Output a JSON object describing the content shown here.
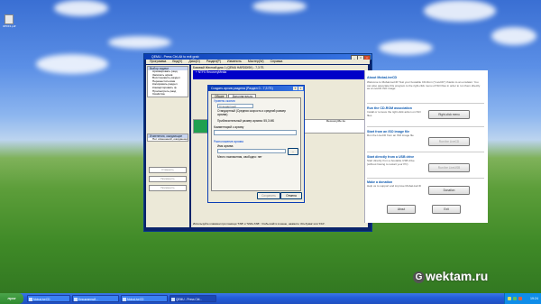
{
  "desktop": {
    "icon_label": "ttPDF1.pdf"
  },
  "qemu": {
    "title": "QEMU - Press Ctrl-Alt to exit grab",
    "menu": [
      "Программа",
      "Вид(V)",
      "Диск(D)",
      "Раздел(P)",
      "Изменить",
      "Мастер(W)",
      "Справка"
    ],
    "left_header": "Выбор задачи",
    "left_items": [
      "Архивировать разд",
      "Записать архив",
      "Восстановить раздел",
      "Переместить/изм",
      "Копировать раздел",
      "Конвертировать ф",
      "Просмотреть разд",
      "Свойства"
    ],
    "left_header2": "Изменения, ожидающие",
    "left_item2": "Нет изменений, ожидающих прим",
    "left_buttons": [
      "Отменить",
      "Применить",
      "Применить"
    ],
    "disk_label": "Базовый Жесткий диск 1 (QEMU HARDDISK) - 7,3 ГБ",
    "disk_entry": "+ NTFS RecoveryMedia",
    "partition_label": "RecoveryMe 2e",
    "status": "Используйте клавиши при помощи 'TAB' и 'Shift+TAB'. Чтобы войти в меню, нажмите 'Alt+буква' или 'F10'."
  },
  "dialog": {
    "title": "Создать архив раздела (Раздел 0 - 7,3 ГБ)",
    "tabs": [
      "Общие",
      "Дополнительно"
    ],
    "compression_group": "Уровень сжатия",
    "compression_value": "Стандартный",
    "compression_desc": "Стандартный (Средняя скорость и средний размер архива)",
    "size_label": "Приблизительный размер архива: 55,3 МБ",
    "comment_label": "Комментарий к архиву",
    "comment_value": "",
    "location_group": "Расположение архива",
    "filename_label": "Имя архива",
    "filename_value": "",
    "browse_label": "...",
    "free_space": "Место назначения, свободно: нет",
    "buttons": [
      "Сохранить",
      "Отмена"
    ]
  },
  "moba": {
    "title": "About MobaLiveCD",
    "intro": "Welcome to MobaLiveCD! Test your bootable CD-Rom (\"LiveCD\") thanks to an emulator. You can also associate this program to the right-click menu of ISO files in order to run them directly as a LiveCD ISO image.",
    "section1": "Run the CD-ROM association",
    "section1_text": "Install or remove the right-click action on ISO files",
    "button1": "Right-click menu",
    "section2": "Start from an ISO image file",
    "section2_text": "Run the LiveCD from an ISO image file",
    "button2": "Run the LiveCD",
    "section3": "Start directly from a USB drive",
    "section3_text": "Start directly from a bootable USB drive (without having to restart your PC)",
    "button3": "Run the LiveUSB",
    "section4": "Make a donation",
    "section4_text": "Help us to support and improve MobaLiveCD",
    "button4": "Donation",
    "about_button": "About",
    "exit_button": "Exit"
  },
  "taskbar": {
    "start": "пуск",
    "tasks": [
      "MobaLiveCD",
      "Безымянный...",
      "MobaLiveCD",
      "QEMU - Press Ctrl..."
    ],
    "clock": "19:24"
  },
  "watermark": {
    "text": "wektam.ru",
    "logo_letter": "G"
  }
}
